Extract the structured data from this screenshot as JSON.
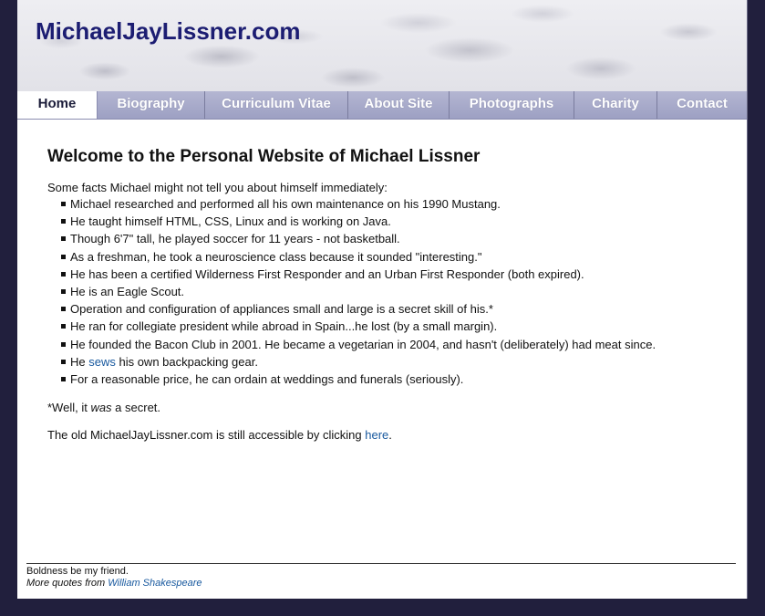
{
  "site": {
    "title": "MichaelJayLissner.com"
  },
  "nav": {
    "items": [
      {
        "label": "Home"
      },
      {
        "label": "Biography"
      },
      {
        "label": "Curriculum Vitae"
      },
      {
        "label": "About Site"
      },
      {
        "label": "Photographs"
      },
      {
        "label": "Charity"
      },
      {
        "label": "Contact"
      }
    ]
  },
  "main": {
    "heading": "Welcome to the Personal Website of Michael Lissner",
    "intro": "Some facts Michael might not tell you about himself immediately:",
    "facts": [
      "Michael researched and performed all his own maintenance on his 1990 Mustang.",
      "He taught himself HTML, CSS, Linux and is working on Java.",
      "Though 6'7\" tall, he played soccer for 11 years - not basketball.",
      "As a freshman, he took a neuroscience class because it sounded \"interesting.\"",
      "He has been a certified Wilderness First Responder and an Urban First Responder (both expired).",
      "He is an Eagle Scout.",
      "Operation and configuration of appliances small and large is a secret skill of his.*",
      "He ran for collegiate president while abroad in Spain...he lost (by a small margin).",
      "He founded the Bacon Club in 2001. He became a vegetarian in 2004, and hasn't (deliberately) had meat since."
    ],
    "sews_fact": {
      "prefix": "He ",
      "link": "sews",
      "suffix": " his own backpacking gear."
    },
    "last_fact": "For a reasonable price, he can ordain at weddings and funerals (seriously).",
    "note": {
      "prefix": "*Well, it ",
      "emphasis": "was",
      "suffix": " a secret."
    },
    "old_site": {
      "prefix": "The old MichaelJayLissner.com is still accessible by clicking ",
      "link": "here",
      "suffix": "."
    }
  },
  "footer": {
    "quote": "Boldness be my friend.",
    "more_prefix": "More quotes from ",
    "author_link": "William Shakespeare"
  }
}
